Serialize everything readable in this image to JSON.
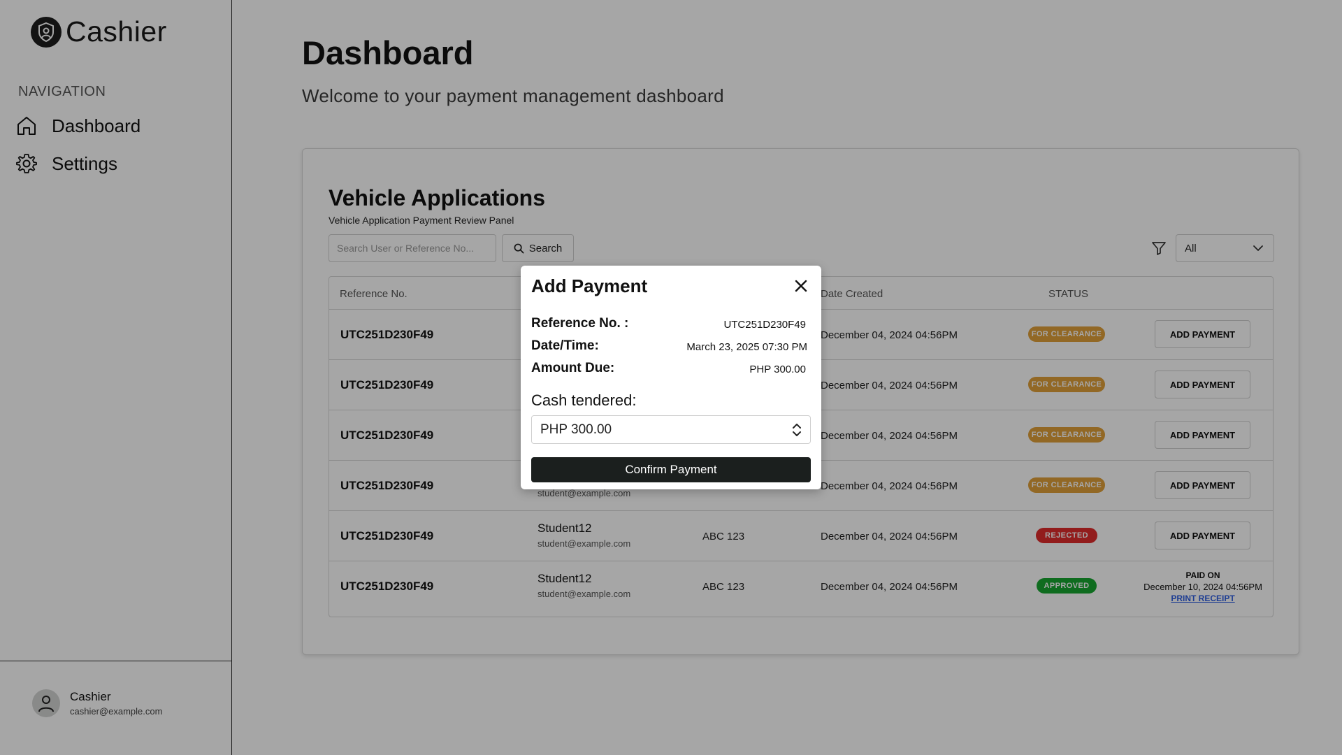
{
  "sidebar": {
    "brand": "Cashier",
    "nav_heading": "NAVIGATION",
    "items": [
      {
        "label": "Dashboard",
        "icon": "home-icon"
      },
      {
        "label": "Settings",
        "icon": "gear-icon"
      }
    ],
    "user": {
      "name": "Cashier",
      "email": "cashier@example.com"
    }
  },
  "header": {
    "title": "Dashboard",
    "subtitle": "Welcome to your payment management dashboard"
  },
  "card": {
    "title": "Vehicle Applications",
    "subtitle": "Vehicle Application Payment Review Panel",
    "search": {
      "placeholder": "Search User or Reference No...",
      "button_label": "Search"
    },
    "filter": {
      "selected": "All"
    },
    "columns": [
      "Reference No.",
      "Date  Created",
      "STATUS"
    ],
    "rows": [
      {
        "ref": "UTC251D230F49",
        "name": "",
        "email": "",
        "plate": "",
        "date": "December 04, 2024 04:56PM",
        "status": "FOR CLEARANCE",
        "action": "ADD PAYMENT"
      },
      {
        "ref": "UTC251D230F49",
        "name": "",
        "email": "",
        "plate": "",
        "date": "December 04, 2024 04:56PM",
        "status": "FOR CLEARANCE",
        "action": "ADD PAYMENT"
      },
      {
        "ref": "UTC251D230F49",
        "name": "",
        "email": "",
        "plate": "",
        "date": "December 04, 2024 04:56PM",
        "status": "FOR CLEARANCE",
        "action": "ADD PAYMENT"
      },
      {
        "ref": "UTC251D230F49",
        "name": "",
        "email": "student@example.com",
        "plate": "",
        "date": "December 04, 2024 04:56PM",
        "status": "FOR CLEARANCE",
        "action": "ADD PAYMENT"
      },
      {
        "ref": "UTC251D230F49",
        "name": "Student12",
        "email": "student@example.com",
        "plate": "ABC 123",
        "date": "December 04, 2024 04:56PM",
        "status": "REJECTED",
        "action": "ADD PAYMENT"
      },
      {
        "ref": "UTC251D230F49",
        "name": "Student12",
        "email": "student@example.com",
        "plate": "ABC 123",
        "date": "December 04, 2024 04:56PM",
        "status": "APPROVED",
        "paid_label": "PAID ON",
        "paid_date": "December 10, 2024 04:56PM",
        "print_label": "PRINT RECEIPT"
      }
    ]
  },
  "modal": {
    "title": "Add Payment",
    "reference_label": "Reference No. :",
    "reference_value": "UTC251D230F49",
    "datetime_label": "Date/Time:",
    "datetime_value": "March 23, 2025 07:30 PM",
    "amount_label": "Amount Due:",
    "amount_value": "PHP 300.00",
    "cash_label": "Cash tendered:",
    "cash_value": "PHP 300.00",
    "confirm_label": "Confirm Payment"
  },
  "colors": {
    "clearance": "#e0a03a",
    "rejected": "#e12c2c",
    "approved": "#18a631",
    "primary_button": "#1b1f1e",
    "link": "#2f5fe0"
  }
}
